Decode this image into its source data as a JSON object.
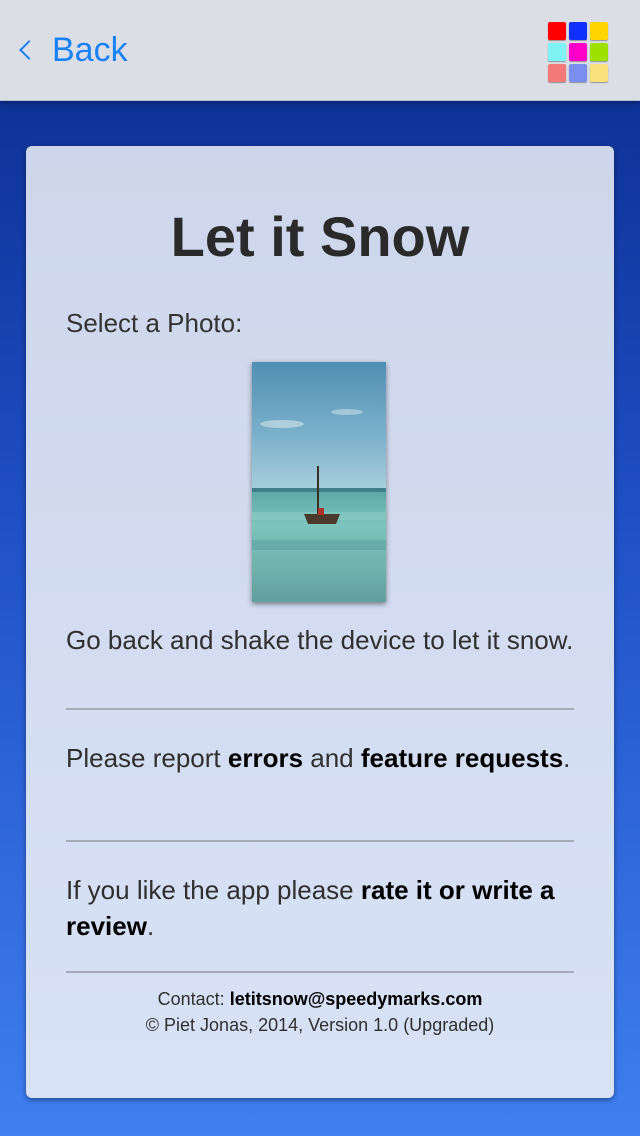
{
  "navbar": {
    "back_label": "Back",
    "back_icon": "chevron-left-icon",
    "app_icon": "color-grid-icon",
    "app_icon_colors": [
      "#ff0000",
      "#1030ff",
      "#ffd400",
      "#7ff3f3",
      "#ff00c8",
      "#9ee000",
      "#f47a7a",
      "#7a8ef0",
      "#f9e07a"
    ],
    "accent_color": "#1a82f7"
  },
  "card": {
    "title": "Let it Snow",
    "select_label": "Select a Photo:",
    "instruction": "Go back and shake the device to let it snow.",
    "report": {
      "prefix": "Please report ",
      "errors_link": "errors",
      "and": " and ",
      "feature_link": "feature requests",
      "suffix": "."
    },
    "rate": {
      "prefix": "If you like the app please ",
      "link": "rate it or write a review",
      "suffix": "."
    },
    "footer": {
      "contact_label": "Contact: ",
      "email": "letitsnow@speedymarks.com",
      "copyright": "© Piet Jonas, 2014, Version 1.0 (Upgraded)"
    }
  }
}
